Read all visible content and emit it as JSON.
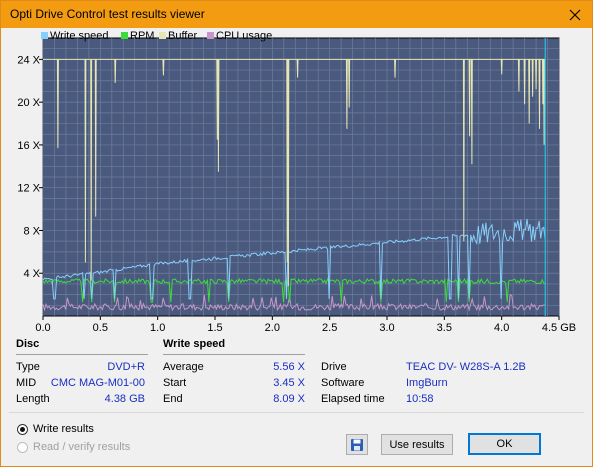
{
  "window": {
    "title": "Opti Drive Control test results viewer"
  },
  "chart_data": {
    "type": "line",
    "legend": [
      "Write speed",
      "RPM",
      "Buffer",
      "CPU usage"
    ],
    "legend_colors": [
      "#87cefa",
      "#3cdc3c",
      "#e6e6b4",
      "#c896c8"
    ],
    "x_unit": "GB",
    "x_ticks": [
      "0.0",
      "0.5",
      "1.0",
      "1.5",
      "2.0",
      "2.5",
      "3.0",
      "3.5",
      "4.0",
      "4.5 GB"
    ],
    "xlim": [
      0,
      4.5
    ],
    "y_ticks": [
      "4 X",
      "8 X",
      "12 X",
      "16 X",
      "20 X",
      "24 X"
    ],
    "ylim": [
      0,
      26
    ],
    "plot_background": "#4a5a7e",
    "grid": true,
    "series": [
      {
        "name": "Write speed",
        "x": [
          0,
          0.5,
          1.0,
          1.5,
          2.0,
          2.5,
          3.0,
          3.5,
          4.0,
          4.38
        ],
        "y": [
          3.45,
          4.1,
          4.9,
          5.4,
          5.9,
          6.4,
          6.9,
          7.4,
          7.9,
          8.09
        ]
      },
      {
        "name": "RPM",
        "x": [
          0,
          4.38
        ],
        "y": [
          3.3,
          3.3
        ]
      },
      {
        "name": "Buffer",
        "x": [
          0,
          4.38
        ],
        "y": [
          24,
          24
        ]
      },
      {
        "name": "CPU usage",
        "x": [
          0,
          4.38
        ],
        "y": [
          0.6,
          0.6
        ]
      }
    ],
    "end_marker_x": 4.38
  },
  "disc": {
    "header": "Disc",
    "rows": [
      {
        "label": "Type",
        "value": "DVD+R"
      },
      {
        "label": "MID",
        "value": "CMC MAG-M01-00"
      },
      {
        "label": "Length",
        "value": "4.38 GB"
      }
    ]
  },
  "write_speed": {
    "header": "Write speed",
    "rows": [
      {
        "label": "Average",
        "value": "5.56 X"
      },
      {
        "label": "Start",
        "value": "3.45 X"
      },
      {
        "label": "End",
        "value": "8.09 X"
      }
    ]
  },
  "info": {
    "rows": [
      {
        "label": "Drive",
        "value": "TEAC DV- W28S-A 1.2B"
      },
      {
        "label": "Software",
        "value": "ImgBurn"
      },
      {
        "label": "Elapsed time",
        "value": "10:58"
      }
    ]
  },
  "options": {
    "write_results": "Write results",
    "read_verify": "Read / verify results"
  },
  "buttons": {
    "use_results": "Use results",
    "ok": "OK"
  }
}
